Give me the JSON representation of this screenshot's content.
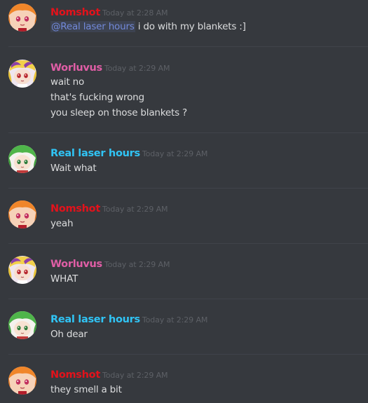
{
  "colors": {
    "background": "#36393e",
    "nomshot": "#e3121b",
    "worluvus": "#e05ea6",
    "real_laser_hours": "#30c4f5",
    "mention": "#7289da",
    "text": "#dcddde",
    "timestamp": "#5d6066"
  },
  "messages": [
    {
      "author": "Nomshot",
      "avatar_icon": "orange-haired-girl-avatar-icon",
      "timestamp": "Today at 2:28 AM",
      "mention": "@Real laser hours",
      "lines": [
        " i do with my blankets :]"
      ]
    },
    {
      "author": "Worluvus",
      "avatar_icon": "blonde-girl-avatar-icon",
      "timestamp": "Today at 2:29 AM",
      "lines": [
        "wait no",
        "that's fucking wrong",
        "you sleep on those blankets ?"
      ]
    },
    {
      "author": "Real laser hours",
      "avatar_icon": "green-haired-girl-avatar-icon",
      "timestamp": "Today at 2:29 AM",
      "lines": [
        "Wait what"
      ]
    },
    {
      "author": "Nomshot",
      "avatar_icon": "orange-haired-girl-avatar-icon",
      "timestamp": "Today at 2:29 AM",
      "lines": [
        "yeah"
      ]
    },
    {
      "author": "Worluvus",
      "avatar_icon": "blonde-girl-avatar-icon",
      "timestamp": "Today at 2:29 AM",
      "lines": [
        "WHAT"
      ]
    },
    {
      "author": "Real laser hours",
      "avatar_icon": "green-haired-girl-avatar-icon",
      "timestamp": "Today at 2:29 AM",
      "lines": [
        "Oh dear"
      ]
    },
    {
      "author": "Nomshot",
      "avatar_icon": "orange-haired-girl-avatar-icon",
      "timestamp": "Today at 2:29 AM",
      "lines": [
        "they smell a bit"
      ]
    }
  ]
}
